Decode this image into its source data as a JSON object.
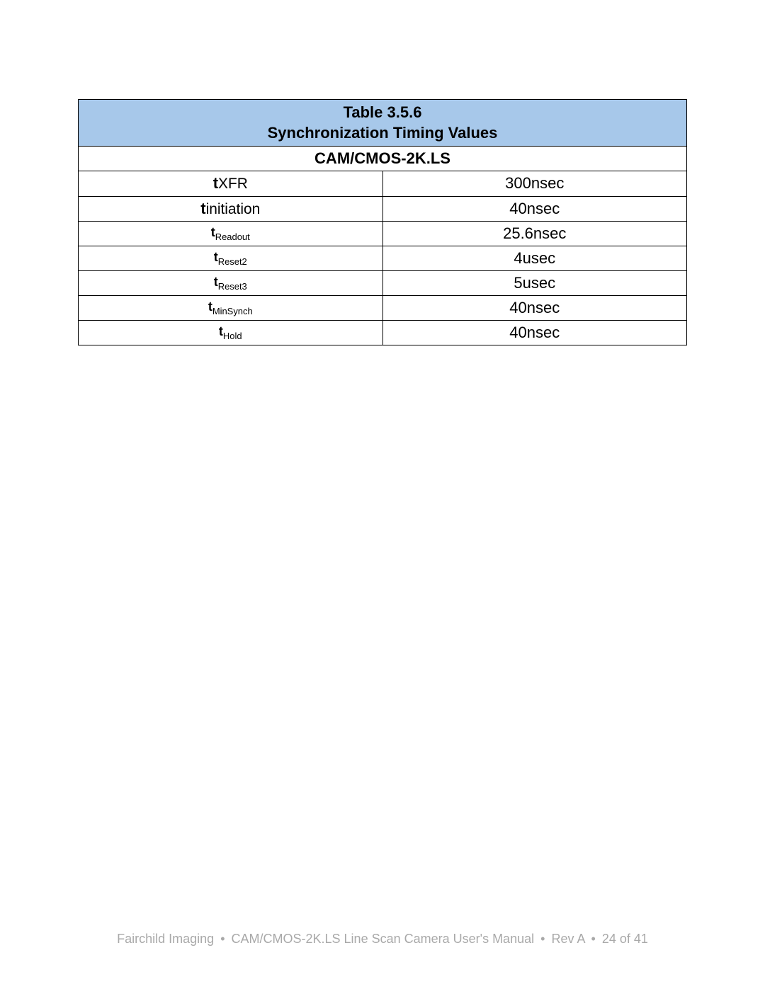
{
  "table": {
    "title_line1": "Table 3.5.6",
    "title_line2": "Synchronization Timing Values",
    "model": "CAM/CMOS-2K.LS",
    "rows": [
      {
        "prefix": "t",
        "sub": "XFR",
        "size": "large",
        "value": "300nsec"
      },
      {
        "prefix": "t",
        "sub": "initiation",
        "size": "large",
        "value": "40nsec"
      },
      {
        "prefix": "t",
        "sub": "Readout",
        "size": "small",
        "value": "25.6nsec"
      },
      {
        "prefix": "t",
        "sub": "Reset2",
        "size": "small",
        "value": "4usec"
      },
      {
        "prefix": "t",
        "sub": "Reset3",
        "size": "small",
        "value": "5usec"
      },
      {
        "prefix": "t",
        "sub": "MinSynch",
        "size": "small",
        "value": "40nsec"
      },
      {
        "prefix": "t",
        "sub": "Hold",
        "size": "small",
        "value": "40nsec"
      }
    ]
  },
  "footer": {
    "company": "Fairchild Imaging",
    "doc": "CAM/CMOS-2K.LS Line Scan Camera User's Manual",
    "rev": "Rev A",
    "page": "24 of 41",
    "sep": "•"
  }
}
